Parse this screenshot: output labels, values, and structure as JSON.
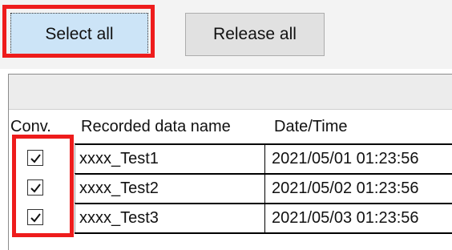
{
  "toolbar": {
    "select_all_label": "Select all",
    "release_all_label": "Release all"
  },
  "grid": {
    "columns": [
      "Conv.",
      "Recorded data name",
      "Date/Time"
    ],
    "rows": [
      {
        "checked": true,
        "name": "xxxx_Test1",
        "datetime": "2021/05/01 01:23:56"
      },
      {
        "checked": true,
        "name": "xxxx_Test2",
        "datetime": "2021/05/02 01:23:56"
      },
      {
        "checked": true,
        "name": "xxxx_Test3",
        "datetime": "2021/05/03 01:23:56"
      }
    ]
  },
  "colors": {
    "highlight": "#ee1c1c",
    "select_button_bg": "#cce4f7",
    "release_button_bg": "#e1e1e1"
  },
  "icons": {
    "checkbox": "checkmark-icon"
  }
}
